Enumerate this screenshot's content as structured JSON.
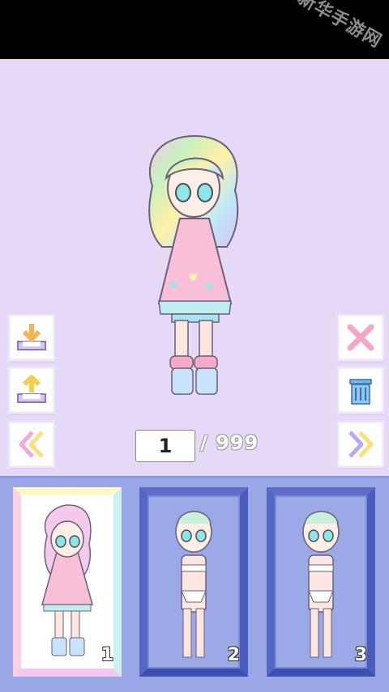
{
  "watermark": {
    "text": "新华手游网"
  },
  "counter": {
    "current": "1",
    "total": "/ 999"
  },
  "buttons": {
    "save": "save-icon",
    "load": "upload-icon",
    "prev": "double-chevron-left-icon",
    "delete": "close-icon",
    "trash": "trash-icon",
    "next": "double-chevron-right-icon"
  },
  "slots": [
    {
      "number": "1",
      "state": "selected"
    },
    {
      "number": "2",
      "state": "empty"
    },
    {
      "number": "3",
      "state": "empty"
    }
  ],
  "colors": {
    "background": "#e6d9f8",
    "tray": "#9aa7e7",
    "frame_inactive": "#4b5cbf"
  }
}
